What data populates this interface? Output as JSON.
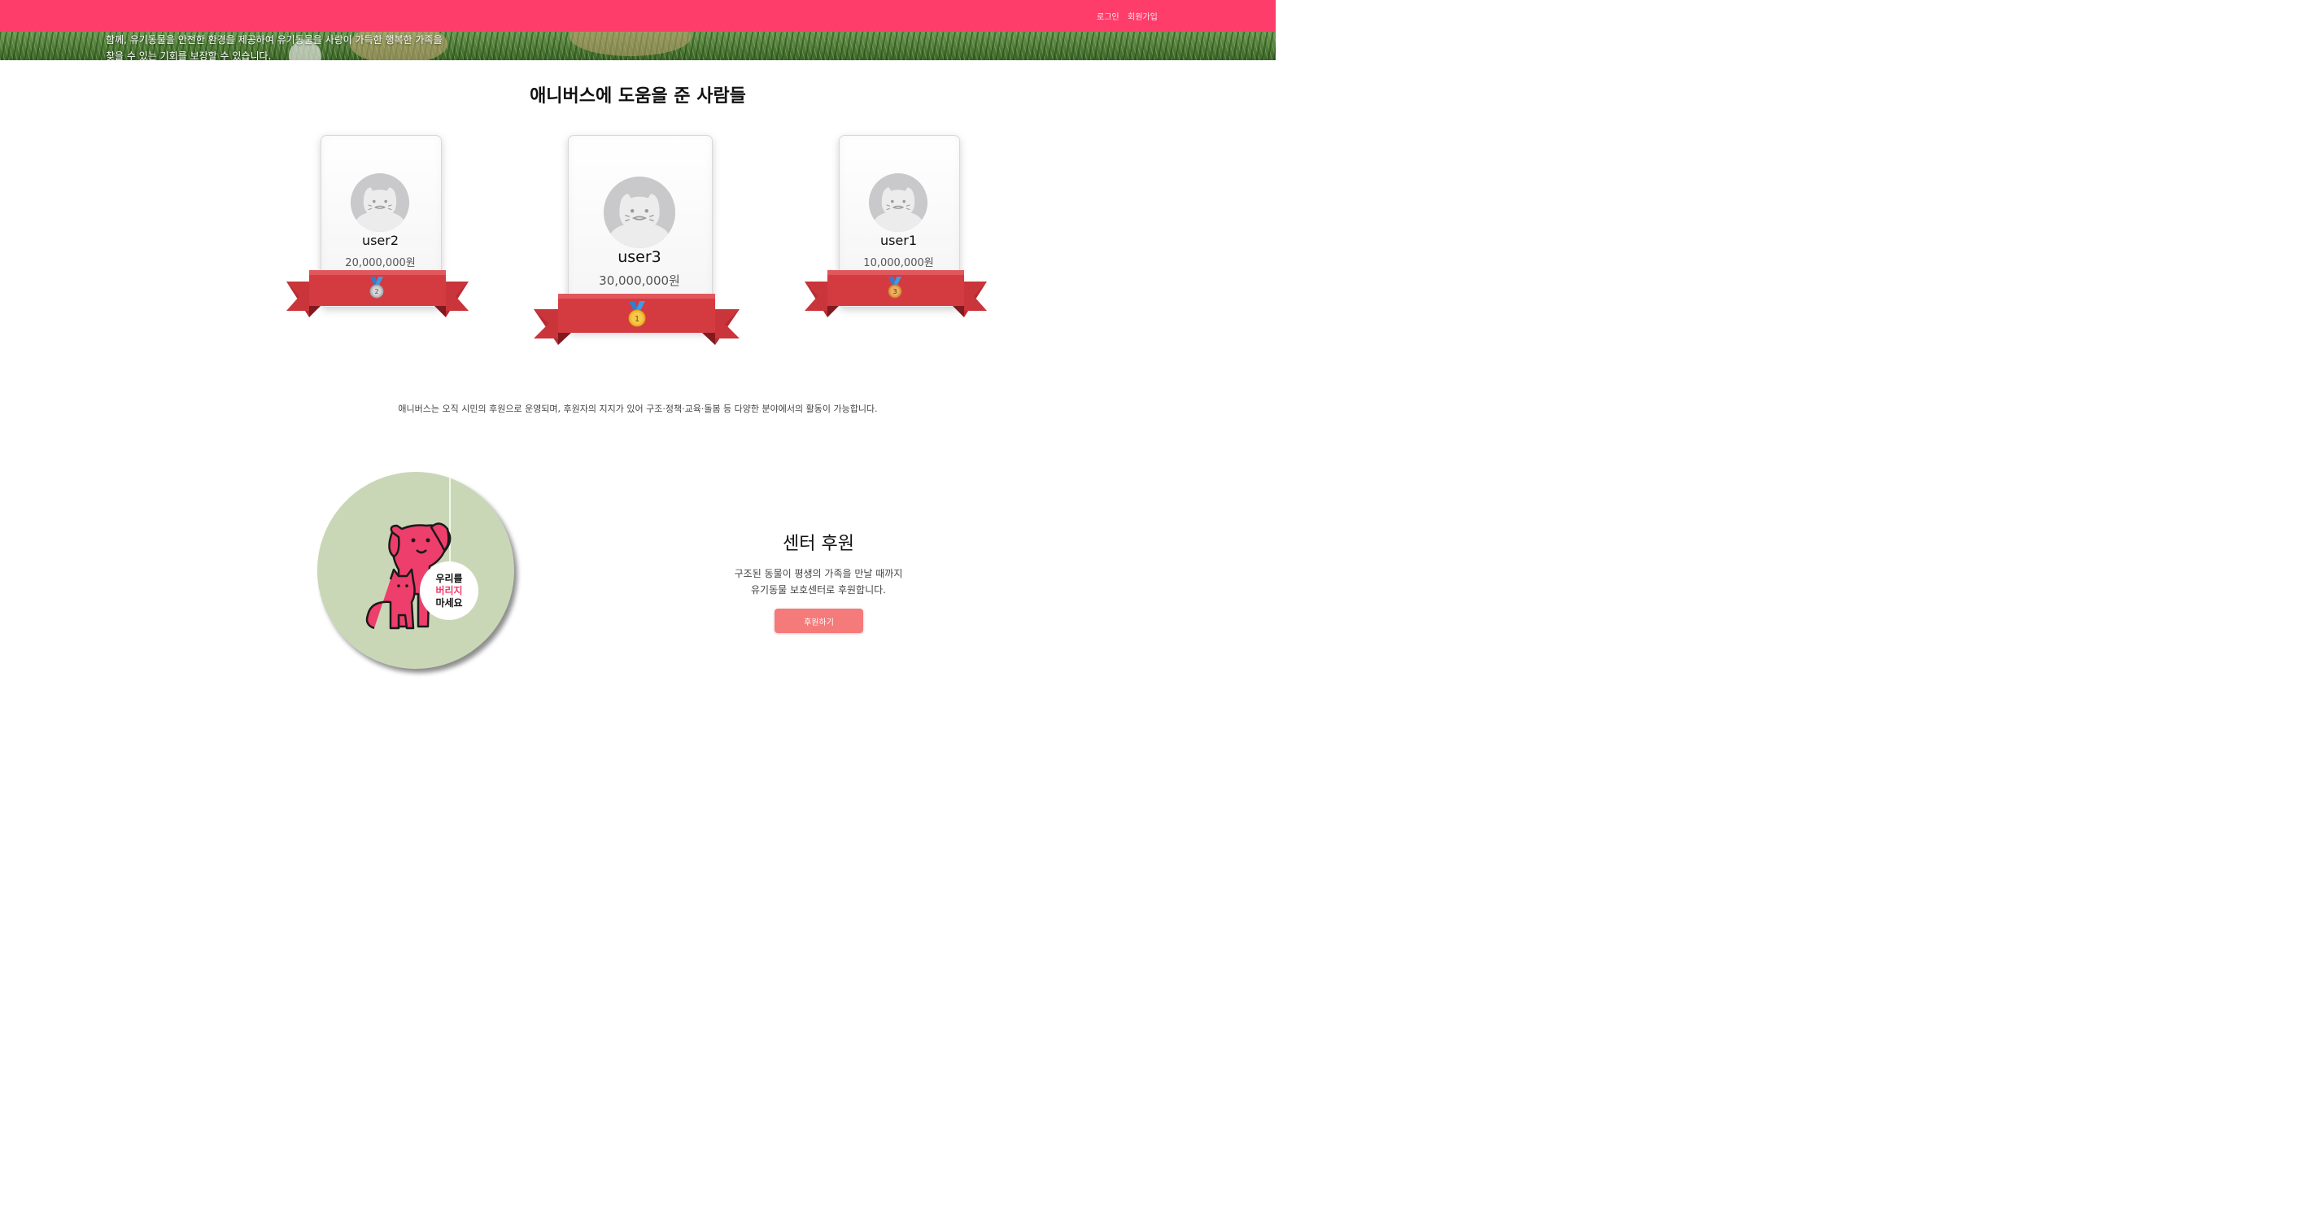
{
  "nav": {
    "login": "로그인",
    "signup": "회원가입"
  },
  "hero": {
    "line1": "함께, 유기동물을 안전한 환경을 제공하여 유기동물을 사랑이 가득한 행복한 가족을",
    "line2": "찾을 수 있는 기회를 보장할 수 있습니다."
  },
  "donors": {
    "title": "애니버스에 도움을 준 사람들",
    "ranks": [
      {
        "rank": "2",
        "name": "user2",
        "amount": "20,000,000원",
        "medal_color": "#bdbdbd"
      },
      {
        "rank": "1",
        "name": "user3",
        "amount": "30,000,000원",
        "medal_color": "#f5b82e"
      },
      {
        "rank": "3",
        "name": "user1",
        "amount": "10,000,000원",
        "medal_color": "#e39a43"
      }
    ]
  },
  "description": "애니버스는 오직 시민의 후원으로 운영되며, 후원자의 지지가 있어 구조·정책·교육·돌봄 등 다양한 분야에서의 활동이 가능합니다.",
  "poster": {
    "line1": "우리를",
    "line2": "버리지",
    "line3": "마세요"
  },
  "support": {
    "title": "센터 후원",
    "line1": "구조된 동물이 평생의 가족을 만날 때까지",
    "line2": "유기동물 보호센터로 후원합니다.",
    "button": "후원하기"
  },
  "colors": {
    "brand": "#ff3d6a",
    "ribbon": "#c9353a",
    "button": "#f57a7a",
    "poster_bg": "#c9d7b7",
    "animal": "#ee3e6b"
  }
}
